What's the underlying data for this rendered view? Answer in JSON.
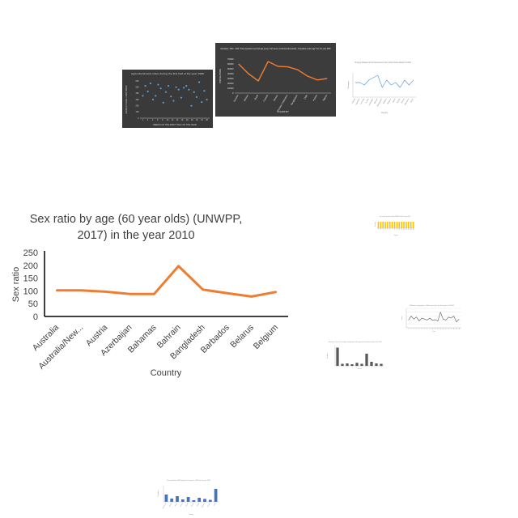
{
  "chart_data": [
    {
      "type": "line",
      "title_lines": [
        "Sex ratio by age (60 year olds) (UNWPP,",
        "2017) in the year 2010"
      ],
      "xlabel": "Country",
      "ylabel": "Sex ratio",
      "categories": [
        "Australia",
        "Australia/New...",
        "Austria",
        "Azerbaijan",
        "Bahamas",
        "Bahrain",
        "Bangladesh",
        "Barbados",
        "Belarus",
        "Belgium"
      ],
      "values": [
        102,
        102,
        97,
        88,
        88,
        197,
        105,
        91,
        78,
        96
      ],
      "yticks": [
        "0",
        "50",
        "100",
        "150",
        "200",
        "250"
      ],
      "ylim": [
        0,
        250
      ],
      "color": "#ed7d31",
      "grid": false
    },
    {
      "type": "scatter",
      "title": "Agricultural land index during the first half of the year 1996",
      "xlabel": "WEEKS OF THE FIRST HALF OF THE YEAR",
      "ylabel": "AGRICULTURAL LAND INDEX",
      "yticks": [
        "600",
        "500",
        "400",
        "300",
        "200",
        "100",
        "0"
      ],
      "xticks": [
        "1",
        "2",
        "4",
        "6",
        "8",
        "10",
        "12",
        "14",
        "16",
        "18",
        "20",
        "22",
        "24",
        "26"
      ],
      "x": [
        1,
        2,
        3,
        4,
        5,
        6,
        7,
        8,
        9,
        10,
        11,
        12,
        13,
        14,
        15,
        16,
        17,
        18,
        19,
        20,
        21,
        22,
        23,
        24,
        25,
        26
      ],
      "values": [
        360,
        520,
        430,
        560,
        300,
        360,
        540,
        480,
        250,
        420,
        520,
        350,
        280,
        500,
        460,
        330,
        490,
        520,
        460,
        200,
        420,
        340,
        580,
        260,
        440,
        300
      ],
      "ylim": [
        0,
        600
      ],
      "color": "#5b9bd5"
    },
    {
      "type": "line",
      "title": "Estimates, 1950 - 2100: Total population by broad age group, both sexes combined (thousands) - Population under age 5 for the year 2065",
      "xlabel": "COUNTRY",
      "ylabel": "POPULATION",
      "yticks": [
        "70000",
        "60000",
        "50000",
        "40000",
        "30000",
        "20000",
        "10000",
        "0"
      ],
      "categories": [
        "Sweden",
        "Bhutan",
        "Brazil",
        "Canada",
        "Mexico",
        "Russian Federation",
        "Bangladesh",
        "Chile",
        "Austria",
        "Nigeria"
      ],
      "values": [
        60000,
        40000,
        25000,
        65000,
        55000,
        54000,
        48000,
        35000,
        27000,
        30000
      ],
      "ylim": [
        0,
        70000
      ],
      "color": "#ed7d31"
    },
    {
      "type": "line",
      "title": "Oil supply, Measured as the financial environment, whole industry adjusted, % (2013)",
      "xlabel": "Country",
      "ylabel": "Oil supply",
      "categories": [
        "Albania",
        "Argentina",
        "Australia",
        "Austria",
        "Azerbaijan",
        "Bahrain",
        "Bangladesh",
        "Belarus",
        "Belgium",
        "Benin",
        "Bolivia",
        "Bosnia",
        "Botswana",
        "Brazil"
      ],
      "values": [
        6,
        6,
        5,
        7,
        8,
        9,
        4,
        7,
        5,
        6,
        4,
        7,
        5,
        7
      ],
      "ylim": [
        0,
        10
      ],
      "color": "#5b9bd5"
    },
    {
      "type": "bar",
      "title": "Sex ratio by age (55 year olds) (UNWPP, 2017) in the year 2050",
      "xlabel": "Country",
      "ylabel": "Sex ratio",
      "categories": [
        "1",
        "2",
        "3",
        "4",
        "5",
        "6",
        "7",
        "8",
        "9",
        "10",
        "11",
        "12",
        "13",
        "14",
        "15",
        "16"
      ],
      "values": [
        95,
        97,
        96,
        94,
        98,
        96,
        95,
        97,
        96,
        95,
        97,
        96,
        94,
        96,
        95,
        97
      ],
      "ylim": [
        0,
        120
      ],
      "color": "#ffc000"
    },
    {
      "type": "line",
      "title": "Wheat imports, Measured in the year 2010",
      "xlabel": "Year",
      "ylabel": "Imports",
      "categories": [
        "1",
        "2",
        "3",
        "4",
        "5",
        "6",
        "7",
        "8",
        "9",
        "10",
        "11",
        "12",
        "13",
        "14",
        "15",
        "16",
        "17",
        "18",
        "19",
        "20"
      ],
      "values": [
        40,
        60,
        45,
        55,
        35,
        50,
        45,
        40,
        50,
        38,
        42,
        35,
        80,
        45,
        40,
        55,
        50,
        60,
        30,
        45
      ],
      "ylim": [
        0,
        100
      ],
      "color": "#595959"
    },
    {
      "type": "bar",
      "title": "Sanitation, Rural, Percentage of population with improved sanitation facilities (%), 1990",
      "xlabel": "Country",
      "ylabel": "Sanitation",
      "categories": [
        "1",
        "2",
        "3",
        "4",
        "5",
        "6",
        "7",
        "8",
        "9",
        "10"
      ],
      "values": [
        90,
        10,
        12,
        8,
        15,
        10,
        60,
        20,
        12,
        10
      ],
      "ylim": [
        0,
        100
      ],
      "color": "#595959"
    },
    {
      "type": "bar",
      "title": "The population (UN Population Prospects, 2018) for the year 1975",
      "xlabel": "Country",
      "ylabel": "Population",
      "categories": [
        "Afghanistan",
        "Albania",
        "Algeria",
        "Andorra",
        "Angola",
        "Anguilla",
        "Antigua",
        "Argentina",
        "Armenia",
        "Aruba"
      ],
      "values": [
        45,
        20,
        35,
        15,
        30,
        10,
        25,
        18,
        12,
        80
      ],
      "ylim": [
        0,
        100
      ],
      "color": "#4472c4"
    }
  ]
}
